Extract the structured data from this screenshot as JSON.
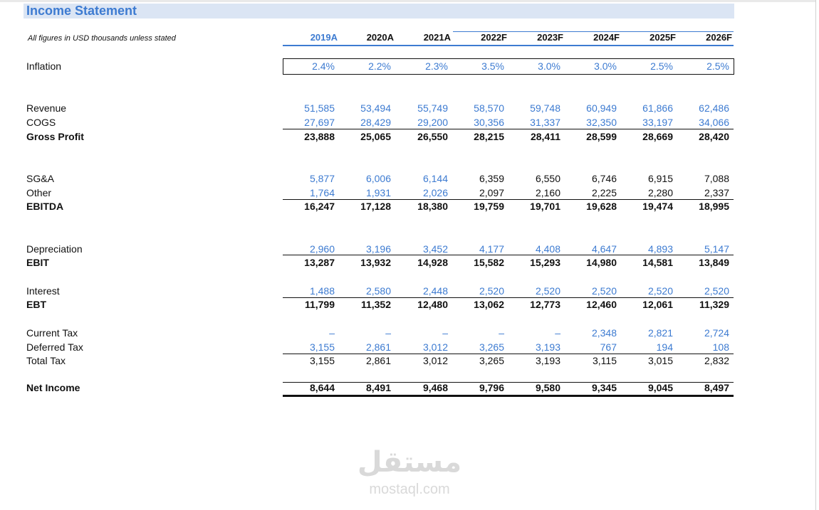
{
  "title": "Income Statement",
  "note": "All figures in USD thousands unless stated",
  "years": [
    "2019A",
    "2020A",
    "2021A",
    "2022F",
    "2023F",
    "2024F",
    "2025F",
    "2026F"
  ],
  "rows": [
    {
      "label": "Inflation",
      "values": [
        "2.4%",
        "2.2%",
        "2.3%",
        "3.5%",
        "3.0%",
        "3.0%",
        "2.5%",
        "2.5%"
      ]
    },
    {
      "label": "Revenue",
      "values": [
        "51,585",
        "53,494",
        "55,749",
        "58,570",
        "59,748",
        "60,949",
        "61,866",
        "62,486"
      ]
    },
    {
      "label": "COGS",
      "values": [
        "27,697",
        "28,429",
        "29,200",
        "30,356",
        "31,337",
        "32,350",
        "33,197",
        "34,066"
      ]
    },
    {
      "label": "Gross Profit",
      "values": [
        "23,888",
        "25,065",
        "26,550",
        "28,215",
        "28,411",
        "28,599",
        "28,669",
        "28,420"
      ]
    },
    {
      "label": "SG&A",
      "values": [
        "5,877",
        "6,006",
        "6,144",
        "6,359",
        "6,550",
        "6,746",
        "6,915",
        "7,088"
      ]
    },
    {
      "label": "Other",
      "values": [
        "1,764",
        "1,931",
        "2,026",
        "2,097",
        "2,160",
        "2,225",
        "2,280",
        "2,337"
      ]
    },
    {
      "label": "EBITDA",
      "values": [
        "16,247",
        "17,128",
        "18,380",
        "19,759",
        "19,701",
        "19,628",
        "19,474",
        "18,995"
      ]
    },
    {
      "label": "Depreciation",
      "values": [
        "2,960",
        "3,196",
        "3,452",
        "4,177",
        "4,408",
        "4,647",
        "4,893",
        "5,147"
      ]
    },
    {
      "label": "EBIT",
      "values": [
        "13,287",
        "13,932",
        "14,928",
        "15,582",
        "15,293",
        "14,980",
        "14,581",
        "13,849"
      ]
    },
    {
      "label": "Interest",
      "values": [
        "1,488",
        "2,580",
        "2,448",
        "2,520",
        "2,520",
        "2,520",
        "2,520",
        "2,520"
      ]
    },
    {
      "label": "EBT",
      "values": [
        "11,799",
        "11,352",
        "12,480",
        "13,062",
        "12,773",
        "12,460",
        "12,061",
        "11,329"
      ]
    },
    {
      "label": "Current Tax",
      "values": [
        "–",
        "–",
        "–",
        "–",
        "–",
        "2,348",
        "2,821",
        "2,724"
      ]
    },
    {
      "label": "Deferred Tax",
      "values": [
        "3,155",
        "2,861",
        "3,012",
        "3,265",
        "3,193",
        "767",
        "194",
        "108"
      ]
    },
    {
      "label": "Total Tax",
      "values": [
        "3,155",
        "2,861",
        "3,012",
        "3,265",
        "3,193",
        "3,115",
        "3,015",
        "2,832"
      ]
    },
    {
      "label": "Net Income",
      "values": [
        "8,644",
        "8,491",
        "9,468",
        "9,796",
        "9,580",
        "9,345",
        "9,045",
        "8,497"
      ]
    }
  ],
  "watermark": {
    "arabic": "مستقل",
    "latin": "mostaql.com"
  },
  "colors": {
    "accent": "#3d7bd1",
    "title_bg": "#dbe5f4"
  }
}
